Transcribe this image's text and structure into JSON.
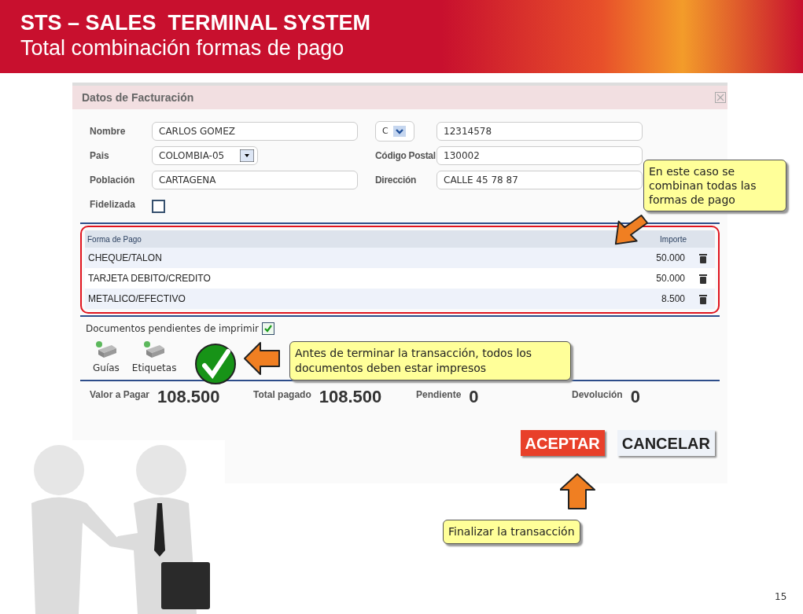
{
  "header": {
    "title": "STS – SALES  TERMINAL SYSTEM",
    "subtitle": "Total combinación formas de pago"
  },
  "dialog": {
    "title": "Datos de Facturación",
    "left_fields": [
      {
        "label": "Nombre",
        "value": "CARLOS GOMEZ",
        "kind": "text"
      },
      {
        "label": "Pais",
        "value": "COLOMBIA-05",
        "kind": "select"
      },
      {
        "label": "Población",
        "value": "CARTAGENA",
        "kind": "text"
      },
      {
        "label": "Fidelizada",
        "kind": "checkbox",
        "checked": false
      }
    ],
    "right_fields": [
      {
        "prefix": "C",
        "value": "12314578",
        "kind": "select_text"
      },
      {
        "label": "Código Postal",
        "value": "130002",
        "kind": "text"
      },
      {
        "label": "Dirección",
        "value": "CALLE 45 78 87",
        "kind": "text"
      }
    ],
    "payments": {
      "columns": [
        "Forma de Pago",
        "Importe"
      ],
      "rows": [
        {
          "method": "CHEQUE/TALON",
          "amount": "50.000"
        },
        {
          "method": "TARJETA DEBITO/CREDITO",
          "amount": "50.000"
        },
        {
          "method": "METALICO/EFECTIVO",
          "amount": "8.500"
        }
      ]
    },
    "pending_docs": {
      "label": "Documentos pendientes de imprimir",
      "checked": true
    },
    "print_buttons": [
      "Guías",
      "Etiquetas"
    ],
    "totals": [
      {
        "label": "Valor a Pagar",
        "value": "108.500"
      },
      {
        "label": "Total pagado",
        "value": "108.500"
      },
      {
        "label": "Pendiente",
        "value": "0"
      },
      {
        "label": "Devolución",
        "value": "0"
      }
    ],
    "buttons": [
      {
        "label": "ACEPTAR",
        "kind": "primary"
      },
      {
        "label": "CANCELAR",
        "kind": "secondary"
      }
    ]
  },
  "callouts": [
    "En este caso se combinan todas las formas de pago",
    "Antes de terminar la transacción, todos los documentos deben estar impresos",
    "Finalizar la transacción"
  ],
  "page_number": "15"
}
